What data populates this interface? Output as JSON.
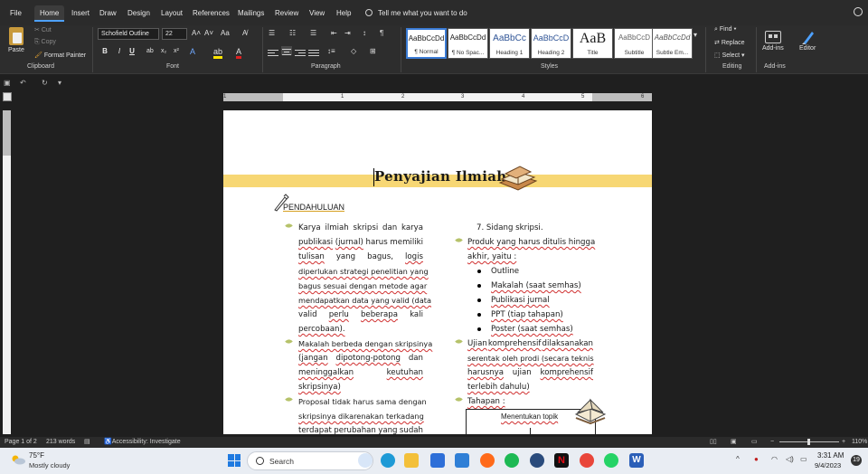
{
  "menu": {
    "items": [
      "File",
      "Home",
      "Insert",
      "Draw",
      "Design",
      "Layout",
      "References",
      "Mailings",
      "Review",
      "View",
      "Help"
    ],
    "active": "Home",
    "tell_me": "Tell me what you want to do"
  },
  "ribbon": {
    "clipboard": {
      "paste": "Paste",
      "cut": "Cut",
      "copy": "Copy",
      "format_painter": "Format Painter",
      "label": "Clipboard"
    },
    "font": {
      "name": "Schofield Outline",
      "size": "22",
      "label": "Font",
      "bold": "B",
      "italic": "I",
      "underline": "U"
    },
    "paragraph": {
      "label": "Paragraph"
    },
    "styles": {
      "label": "Styles",
      "tiles": [
        {
          "preview": "AaBbCcDd",
          "name": "¶ Normal"
        },
        {
          "preview": "AaBbCcDd",
          "name": "¶ No Spac..."
        },
        {
          "preview": "AaBbCc",
          "name": "Heading 1"
        },
        {
          "preview": "AaBbCcD",
          "name": "Heading 2"
        },
        {
          "preview": "AaB",
          "name": "Title"
        },
        {
          "preview": "AaBbCcD",
          "name": "Subtitle"
        },
        {
          "preview": "AaBbCcDd",
          "name": "Subtle Em..."
        }
      ]
    },
    "editing": {
      "find": "Find",
      "replace": "Replace",
      "select": "Select",
      "label": "Editing"
    },
    "addins": {
      "button": "Add-ins",
      "label": "Add-ins"
    },
    "editor": {
      "button": "Editor"
    }
  },
  "ruler": {
    "numbers": [
      "1",
      "1",
      "2",
      "3",
      "4",
      "5",
      "6"
    ]
  },
  "document": {
    "title": "Penyajian Ilmiah",
    "section_heading": "PENDAHULUAN",
    "left_column": [
      [
        "Karya",
        "ilmiah",
        "skripsi",
        "dan",
        "karya"
      ],
      [
        "publikasi",
        "(jurnal)",
        "harus",
        "memiliki"
      ],
      [
        "tulisan",
        "yang",
        "bagus,",
        "logis"
      ],
      [
        "diperlukan strategi penelitian yang"
      ],
      [
        "bagus sesuai dengan metode agar"
      ],
      [
        "mendapatkan data yang valid (data"
      ],
      [
        "valid",
        "perlu",
        "beberapa",
        "kali"
      ],
      [
        "percobaan)."
      ],
      [
        "Makalah berbeda dengan skripsinya"
      ],
      [
        "(jangan",
        "dipotong-potong",
        "dan"
      ],
      [
        "meninggalkan",
        "keutuhan"
      ],
      [
        "skripsinya)"
      ],
      [
        "Proposal tidak harus sama dengan"
      ],
      [
        "skripsinya dikarenakan terkadang"
      ],
      [
        "terdapat",
        "perubahan",
        "yang",
        "sudah"
      ]
    ],
    "right_column": {
      "numbered_item": "7.   Sidang skripsi.",
      "lines": [
        "Produk yang harus ditulis hingga",
        "akhir, yaitu :"
      ],
      "bullets": [
        "Outline",
        "Makalah (saat semhas)",
        "Publikasi jurnal",
        "PPT (tiap tahapan)",
        "Poster (saat semhas)"
      ],
      "exam_lines": [
        [
          "Ujian",
          "komprehensif",
          "dilaksanakan"
        ],
        [
          "serentak oleh prodi (secara teknis"
        ],
        [
          "harusnya",
          "ujian",
          "komprehensif"
        ],
        [
          "terlebih dahulu)"
        ]
      ],
      "stages_label": "Tahapan :",
      "flow_first_step": "Menentukan topik"
    }
  },
  "status": {
    "page": "Page 1 of 2",
    "words": "213 words",
    "accessibility": "Accessibility: Investigate",
    "zoom": "110%"
  },
  "taskbar": {
    "temperature": "75°F",
    "weather": "Mostly cloudy",
    "search_placeholder": "Search",
    "time": "3:31 AM",
    "date": "9/4/2023",
    "notifications": "19"
  }
}
